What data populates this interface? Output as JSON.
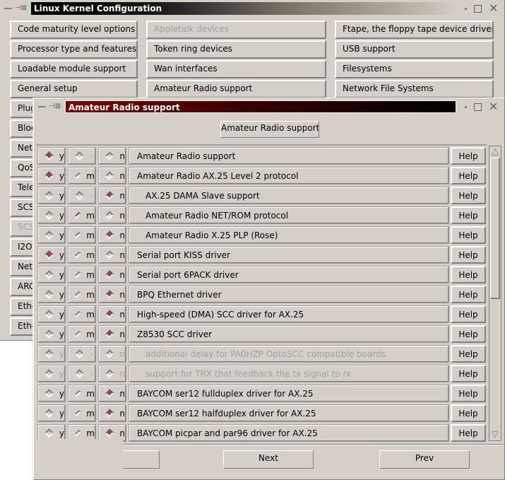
{
  "main_window": {
    "title": "Linux Kernel Configuration",
    "col1": [
      {
        "label": "Code maturity level options",
        "enabled": true
      },
      {
        "label": "Processor type and features",
        "enabled": true
      },
      {
        "label": "Loadable module support",
        "enabled": true
      },
      {
        "label": "General setup",
        "enabled": true
      },
      {
        "label": "Plug",
        "enabled": true
      },
      {
        "label": "Bloc",
        "enabled": true
      },
      {
        "label": "Netw",
        "enabled": true
      },
      {
        "label": "QoS",
        "enabled": true
      },
      {
        "label": "Tele",
        "enabled": true
      },
      {
        "label": "SCS",
        "enabled": true
      },
      {
        "label": "SCS",
        "enabled": false
      },
      {
        "label": "I2O",
        "enabled": true
      },
      {
        "label": "Netw",
        "enabled": true
      },
      {
        "label": "ARC",
        "enabled": true
      },
      {
        "label": "Ethe",
        "enabled": true
      },
      {
        "label": "Ethe",
        "enabled": true
      }
    ],
    "col2": [
      {
        "label": "Appletalk devices",
        "enabled": false
      },
      {
        "label": "Token ring devices",
        "enabled": true
      },
      {
        "label": "Wan interfaces",
        "enabled": true
      },
      {
        "label": "Amateur Radio support",
        "enabled": true
      }
    ],
    "col3": [
      {
        "label": "Ftape, the floppy tape device driver",
        "enabled": true
      },
      {
        "label": "USB support",
        "enabled": true
      },
      {
        "label": "Filesystems",
        "enabled": true
      },
      {
        "label": "Network File Systems",
        "enabled": true
      }
    ]
  },
  "dialog": {
    "title": "Amateur Radio support",
    "header_button": "Amateur Radio support",
    "help_label": "Help",
    "rows": [
      {
        "label": "Amateur Radio support",
        "y": "y",
        "m": "-",
        "n": "n",
        "value": "y",
        "indent": false,
        "enabled": true
      },
      {
        "label": "Amateur Radio AX.25 Level 2 protocol",
        "y": "y",
        "m": "m",
        "n": "n",
        "value": "y",
        "indent": false,
        "enabled": true
      },
      {
        "label": "AX.25 DAMA Slave support",
        "y": "y",
        "m": "-",
        "n": "n",
        "value": "n",
        "indent": true,
        "enabled": true
      },
      {
        "label": "Amateur Radio NET/ROM protocol",
        "y": "y",
        "m": "m",
        "n": "n",
        "value": "m",
        "indent": true,
        "enabled": true
      },
      {
        "label": "Amateur Radio X.25 PLP (Rose)",
        "y": "y",
        "m": "m",
        "n": "n",
        "value": "n",
        "indent": true,
        "enabled": true
      },
      {
        "label": "Serial port KISS driver",
        "y": "y",
        "m": "m",
        "n": "n",
        "value": "y",
        "indent": false,
        "enabled": true
      },
      {
        "label": "Serial port 6PACK driver",
        "y": "y",
        "m": "m",
        "n": "n",
        "value": "n",
        "indent": false,
        "enabled": true
      },
      {
        "label": "BPQ Ethernet driver",
        "y": "y",
        "m": "m",
        "n": "n",
        "value": "n",
        "indent": false,
        "enabled": true
      },
      {
        "label": "High-speed (DMA) SCC driver for AX.25",
        "y": "y",
        "m": "m",
        "n": "n",
        "value": "n",
        "indent": false,
        "enabled": true
      },
      {
        "label": "Z8530 SCC driver",
        "y": "y",
        "m": "m",
        "n": "n",
        "value": "n",
        "indent": false,
        "enabled": true
      },
      {
        "label": "additional delay for PA0HZP OptoSCC compatible boards",
        "y": "y",
        "m": "-",
        "n": "n",
        "value": "",
        "indent": true,
        "enabled": false
      },
      {
        "label": "support for TRX that feedback the tx signal to rx",
        "y": "y",
        "m": "-",
        "n": "n",
        "value": "",
        "indent": true,
        "enabled": false
      },
      {
        "label": "BAYCOM ser12 fullduplex driver for AX.25",
        "y": "y",
        "m": "m",
        "n": "n",
        "value": "n",
        "indent": false,
        "enabled": true
      },
      {
        "label": "BAYCOM ser12 halfduplex driver for AX.25",
        "y": "y",
        "m": "m",
        "n": "n",
        "value": "n",
        "indent": false,
        "enabled": true
      },
      {
        "label": "BAYCOM picpar and par96 driver for AX.25",
        "y": "y",
        "m": "m",
        "n": "n",
        "value": "n",
        "indent": false,
        "enabled": true
      }
    ],
    "footer": {
      "main_menu_label": "",
      "next_label": "Next",
      "prev_label": "Prev"
    }
  },
  "colors": {
    "face": "#d4d0c8",
    "selected_radio": "#b03060",
    "dialog_title_start": "#7a0000",
    "dialog_title_end": "#000000",
    "main_title_start": "#000000",
    "main_title_end": "#d4d0c8"
  }
}
